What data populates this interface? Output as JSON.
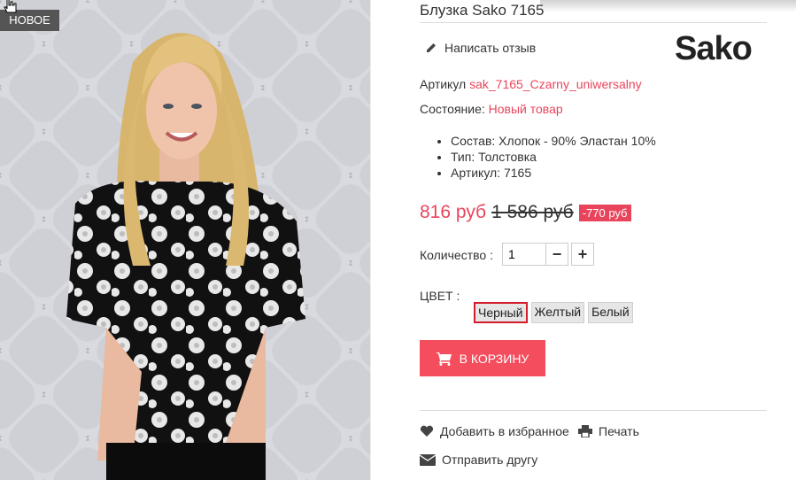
{
  "product": {
    "badge": "НОВОЕ",
    "title": "Блузка Sako 7165",
    "review_link": "Написать отзыв",
    "brand_logo": "Sako",
    "article_label": "Артикул",
    "article_value": "sak_7165_Czarny_uniwersalny",
    "condition_label": "Состояние:",
    "condition_value": "Новый товар",
    "features": [
      "Состав: Хлопок - 90% Эластан 10%",
      "Тип: Толстовка",
      "Артикул:  7165"
    ],
    "price": "816 руб",
    "old_price": "1 586 руб",
    "discount": "-770 руб",
    "quantity_label": "Количество :",
    "quantity_value": "1",
    "minus_label": "−",
    "plus_label": "+",
    "color_label": "ЦВЕТ :",
    "colors": [
      "Черный",
      "Желтый",
      "Белый"
    ],
    "selected_color": "Черный",
    "cart_button": "В КОРЗИНУ",
    "add_favorites": "Добавить в избранное",
    "print": "Печать",
    "send_friend": "Отправить другу"
  },
  "colors": {
    "accent": "#e8455c",
    "cart_button_bg": "#f44d5d",
    "badge_bg": "#555555",
    "selected_border": "#d21d2d"
  },
  "icons": [
    "pencil-icon",
    "cart-icon",
    "heart-icon",
    "printer-icon",
    "envelope-icon",
    "hand-cursor-icon"
  ]
}
